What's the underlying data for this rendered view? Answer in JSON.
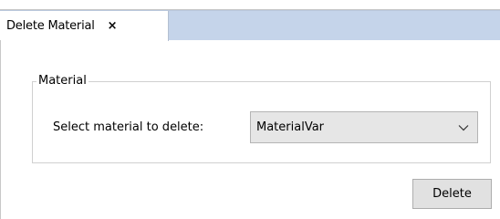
{
  "tab": {
    "title": "Delete Material",
    "close_glyph": "×"
  },
  "groupbox": {
    "title": "Material"
  },
  "form": {
    "select_label": "Select material to delete:",
    "selected_material": "MaterialVar"
  },
  "actions": {
    "delete_label": "Delete"
  },
  "colors": {
    "tab_strip": "#c5d4ea",
    "combo_bg": "#e6e6e6",
    "button_bg": "#e1e1e1"
  }
}
